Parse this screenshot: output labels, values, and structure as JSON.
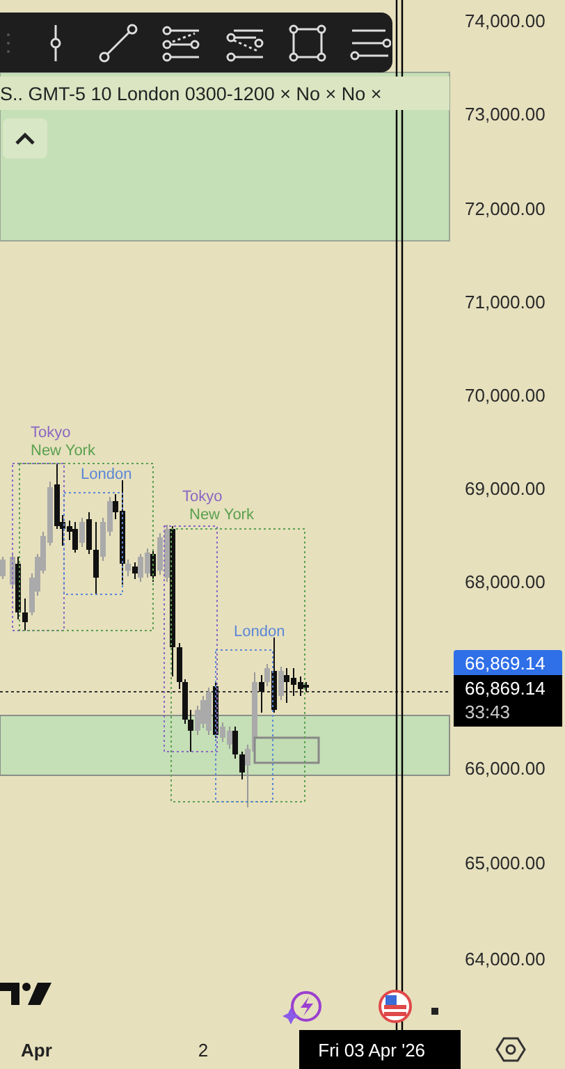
{
  "legend": "S.. GMT-5 10 London 0300-1200 × No × No ×",
  "sessions": [
    {
      "label": "Tokyo",
      "color": "#8a66c4"
    },
    {
      "label": "New York",
      "color": "#5aa04e"
    },
    {
      "label": "London",
      "color": "#5b86d6"
    },
    {
      "label": "Tokyo",
      "color": "#8a66c4"
    },
    {
      "label": "New York",
      "color": "#5aa04e"
    },
    {
      "label": "London",
      "color": "#5b86d6"
    }
  ],
  "price_axis": {
    "labels": [
      "74,000.00",
      "73,000.00",
      "72,000.00",
      "71,000.00",
      "70,000.00",
      "69,000.00",
      "68,000.00",
      "66,000.00",
      "65,000.00",
      "64,000.00"
    ]
  },
  "last_price": {
    "value": "66,869.14",
    "close": "66,869.14",
    "countdown": "33:43"
  },
  "time_axis": {
    "labels": [
      "Apr",
      "2"
    ],
    "cursor": "Fri 03 Apr '26"
  }
}
